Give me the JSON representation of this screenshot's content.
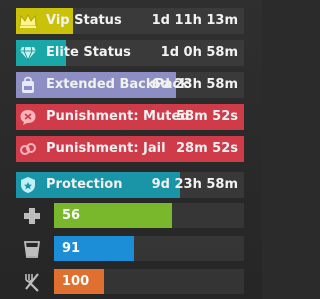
{
  "statuses": [
    {
      "label": "Vip Status",
      "time": "1d 11h 13m",
      "icon": "crown-icon",
      "color": "#c9c10a",
      "fill_fraction": 0.25
    },
    {
      "label": "Elite Status",
      "time": "1d 0h 58m",
      "icon": "diamond-icon",
      "color": "#19a7a7",
      "fill_fraction": 0.22
    },
    {
      "label": "Extended BackPack",
      "time": "6d 23h 58m",
      "icon": "backpack-icon",
      "color": "#8d8fc4",
      "fill_fraction": 0.7
    },
    {
      "label": "Punishment: Muted",
      "time": "58m 52s",
      "icon": "mute-icon",
      "color": "#cf3b49",
      "fill_fraction": 1.0
    },
    {
      "label": "Punishment: Jail",
      "time": "28m 52s",
      "icon": "jail-icon",
      "color": "#cf3b49",
      "fill_fraction": 1.0
    },
    {
      "label": "Protection",
      "time": "9d 23h 58m",
      "icon": "shield-icon",
      "color": "#1a95a8",
      "fill_fraction": 0.72
    }
  ],
  "vitals": [
    {
      "value": "56",
      "icon": "health-plus-icon",
      "color": "#79b82c",
      "fill_fraction": 0.52
    },
    {
      "value": "91",
      "icon": "water-cup-icon",
      "color": "#1c8ed7",
      "fill_fraction": 0.42
    },
    {
      "value": "100",
      "icon": "fork-knife-icon",
      "color": "#e0702f",
      "fill_fraction": 0.27
    }
  ]
}
